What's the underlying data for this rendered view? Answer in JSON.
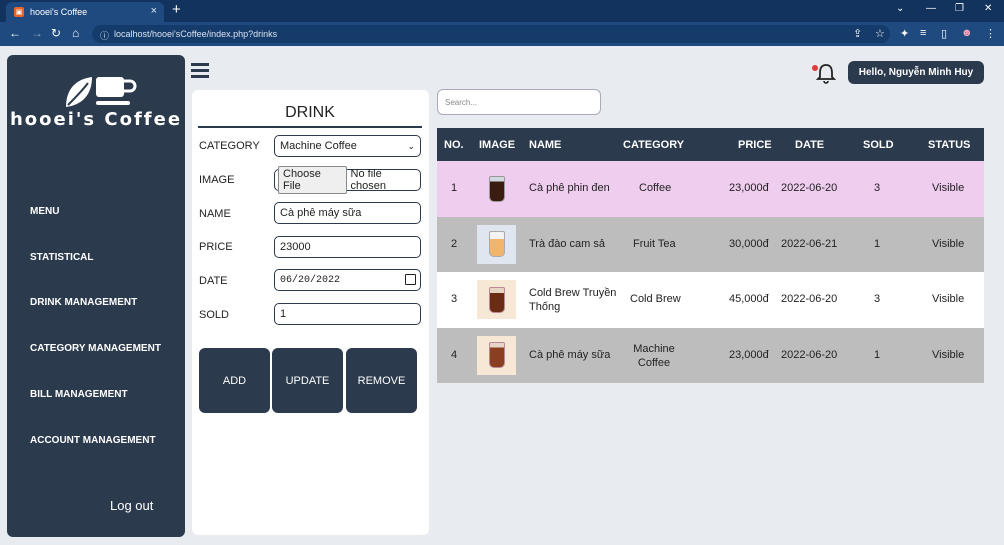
{
  "browser": {
    "tab_title": "hooei's Coffee",
    "url": "localhost/hooei'sCoffee/index.php?drinks"
  },
  "sidebar": {
    "brand": "hooei's Coffee",
    "items": [
      {
        "label": "MENU"
      },
      {
        "label": "STATISTICAL"
      },
      {
        "label": "DRINK MANAGEMENT"
      },
      {
        "label": "CATEGORY MANAGEMENT"
      },
      {
        "label": "BILL MANAGEMENT"
      },
      {
        "label": "ACCOUNT MANAGEMENT"
      }
    ],
    "logout": "Log out"
  },
  "header": {
    "greeting": "Hello, Nguyễn Minh Huy"
  },
  "form": {
    "title": "DRINK",
    "category_label": "CATEGORY",
    "category_value": "Machine Coffee",
    "image_label": "IMAGE",
    "file_button": "Choose File",
    "file_status": "No file chosen",
    "name_label": "NAME",
    "name_value": "Cà phê máy sữa",
    "price_label": "PRICE",
    "price_value": "23000",
    "date_label": "DATE",
    "date_value": "06/20/2022",
    "sold_label": "SOLD",
    "sold_value": "1",
    "add": "ADD",
    "update": "UPDATE",
    "remove": "REMOVE"
  },
  "search": {
    "placeholder": "Search..."
  },
  "table": {
    "headers": [
      "NO.",
      "IMAGE",
      "NAME",
      "CATEGORY",
      "PRICE",
      "DATE",
      "SOLD",
      "STATUS"
    ],
    "rows": [
      {
        "no": "1",
        "name": "Cà phê phin đen",
        "category": "Coffee",
        "price": "23,000đ",
        "date": "2022-06-20",
        "sold": "3",
        "status": "Visible"
      },
      {
        "no": "2",
        "name": "Trà đào cam sả",
        "category": "Fruit Tea",
        "price": "30,000đ",
        "date": "2022-06-21",
        "sold": "1",
        "status": "Visible"
      },
      {
        "no": "3",
        "name": "Cold Brew Truyền Thống",
        "category": "Cold Brew",
        "price": "45,000đ",
        "date": "2022-06-20",
        "sold": "3",
        "status": "Visible"
      },
      {
        "no": "4",
        "name": "Cà phê máy sữa",
        "category": "Machine Coffee",
        "price": "23,000đ",
        "date": "2022-06-20",
        "sold": "1",
        "status": "Visible"
      }
    ]
  },
  "colors": {
    "primary": "#2b3a4d",
    "row_highlight": "#efcdef",
    "row_gray": "#bdbdbd",
    "row_white": "#ffffff"
  }
}
